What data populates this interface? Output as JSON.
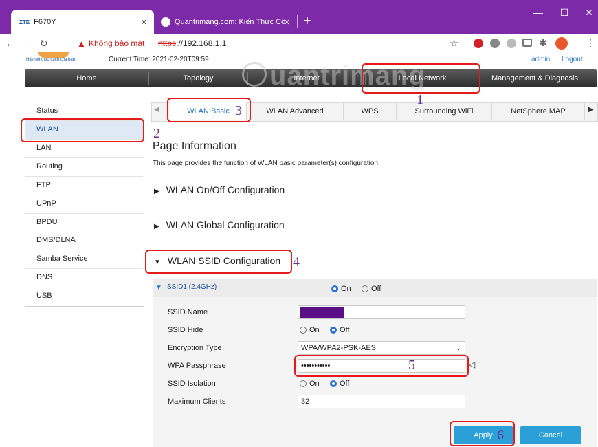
{
  "browser": {
    "tabs": [
      {
        "label": "F670Y",
        "logo": "ZTE",
        "close": "✕"
      },
      {
        "label": "Quantrimang.com: Kiến Thức Cô",
        "close": "✕"
      }
    ],
    "new_tab": "+",
    "window": {
      "minimize": "—",
      "maximize": "☐",
      "close": "✕"
    },
    "address": {
      "security_label": "Không bảo mật",
      "url_scheme": "https",
      "url_rest": "://192.168.1.1"
    }
  },
  "router": {
    "slogan": "Hãy nói theo cách của bạn",
    "current_time": "Current Time: 2021-02-20T09:59",
    "user": "admin",
    "logout": "Logout",
    "menu": [
      "Home",
      "Topology",
      "Internet",
      "Local Network",
      "Management & Diagnosis"
    ],
    "sidebar": [
      "Status",
      "WLAN",
      "LAN",
      "Routing",
      "FTP",
      "UPnP",
      "BPDU",
      "DMS/DLNA",
      "Samba Service",
      "DNS",
      "USB"
    ],
    "subtabs": [
      "WLAN Basic",
      "WLAN Advanced",
      "WPS",
      "Surrounding WiFi",
      "NetSphere MAP"
    ],
    "page_title": "Page Information",
    "page_desc": "This page provides the function of WLAN basic parameter(s) configuration.",
    "sections": [
      "WLAN On/Off Configuration",
      "WLAN Global Configuration",
      "WLAN SSID Configuration"
    ],
    "ssid": {
      "name": "SSID1 (2.4GHz)",
      "on": "On",
      "off": "Off",
      "fields": {
        "ssid_name": "SSID Name",
        "ssid_hide": "SSID Hide",
        "encryption": "Encryption Type",
        "passphrase": "WPA Passphrase",
        "isolation": "SSID Isolation",
        "max_clients": "Maximum Clients"
      },
      "encryption_value": "WPA/WPA2-PSK-AES",
      "passphrase_value": "•••••••••••",
      "max_clients_value": "32"
    },
    "apply": "Apply",
    "cancel": "Cancel"
  },
  "annotations": [
    "1",
    "2",
    "3",
    "4",
    "5",
    "6"
  ],
  "watermark": "uantrimang",
  "colors": {
    "browser_frame": "#7c2aa8",
    "annotation": "#e31b1b",
    "annotation_number": "#6a2f90",
    "button": "#2a9fd8",
    "ssid_swatch": "#5b0f86"
  }
}
